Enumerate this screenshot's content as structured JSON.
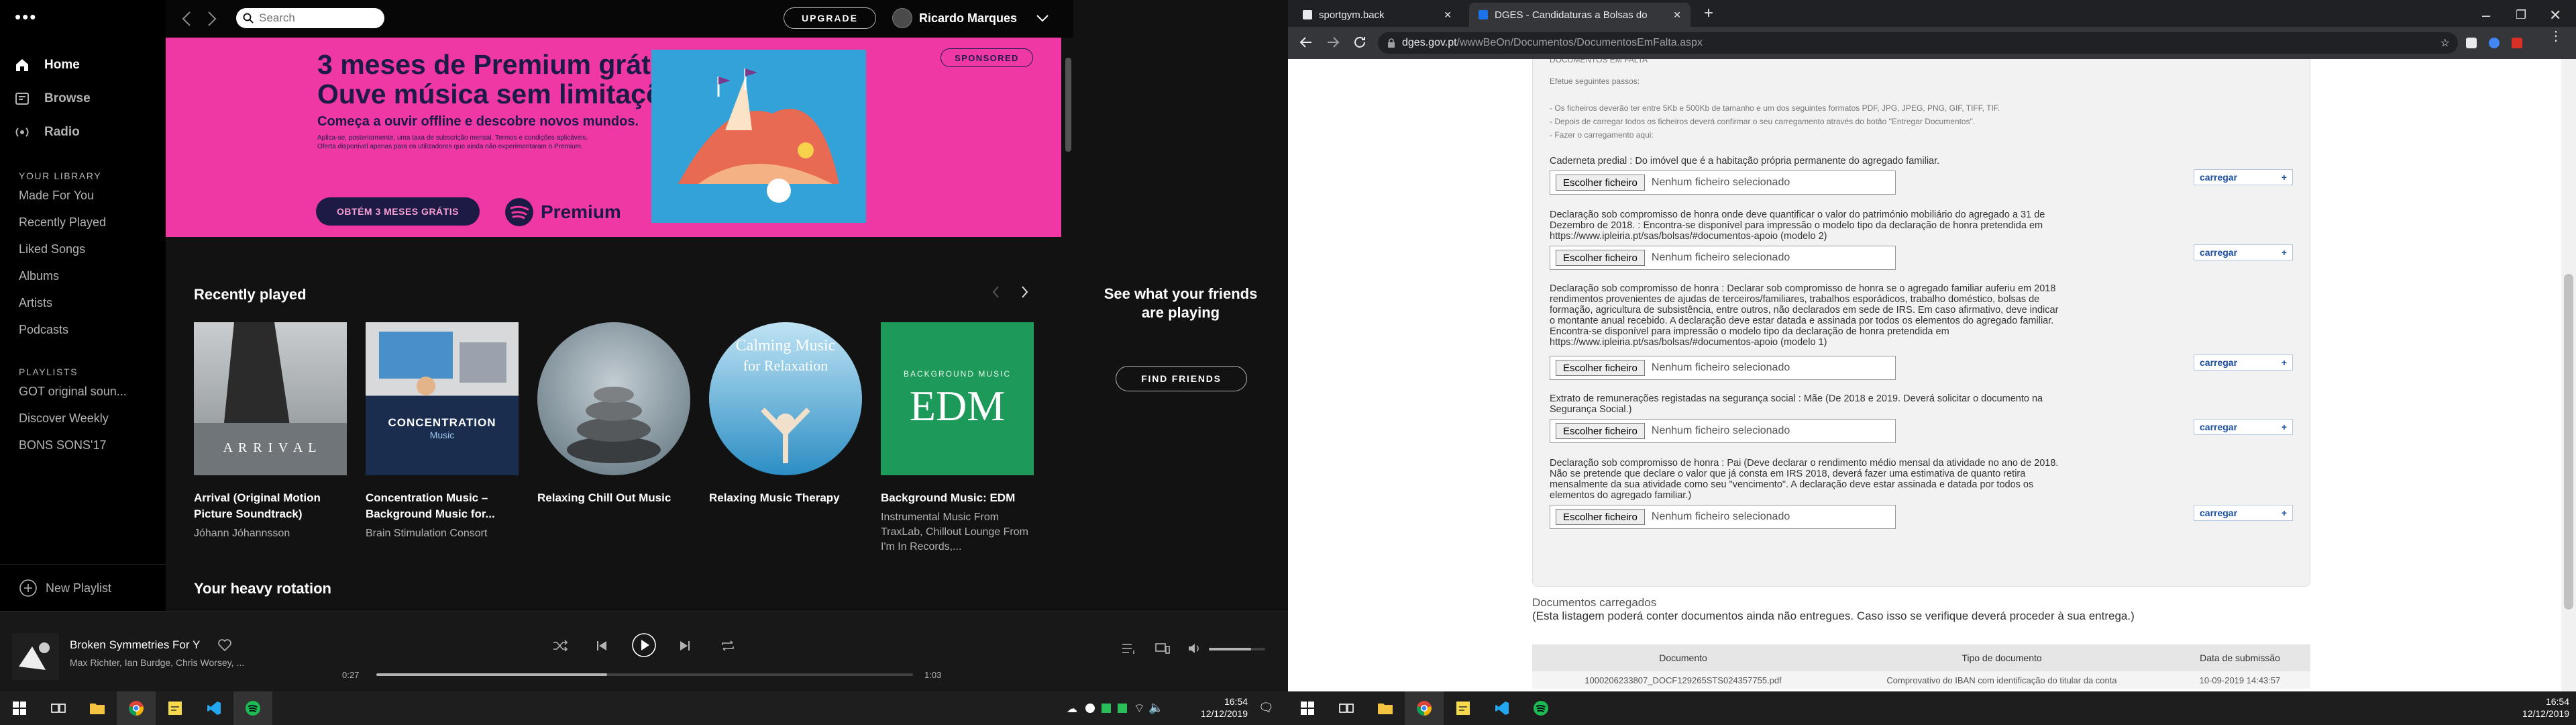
{
  "spotify": {
    "search_placeholder": "Search",
    "upgrade_label": "UPGRADE",
    "user_name": "Ricardo Marques",
    "nav": [
      {
        "label": "Home",
        "icon": "home-icon"
      },
      {
        "label": "Browse",
        "icon": "browse-icon"
      },
      {
        "label": "Radio",
        "icon": "radio-icon"
      }
    ],
    "library_header": "YOUR LIBRARY",
    "library": [
      "Made For You",
      "Recently Played",
      "Liked Songs",
      "Albums",
      "Artists",
      "Podcasts"
    ],
    "playlists_header": "PLAYLISTS",
    "playlists": [
      "GOT original soun...",
      "Discover Weekly",
      "BONS SONS'17"
    ],
    "new_playlist": "New Playlist",
    "ad": {
      "headline_1": "3 meses de Premium grátis.",
      "headline_2": "Ouve música sem limitações.",
      "subline": "Começa a ouvir offline e descobre novos mundos.",
      "fine_1": "Aplica-se, posteriormente, uma taxa de subscrição mensal. Termos e condições aplicáveis.",
      "fine_2": "Oferta disponível apenas para os utilizadores que ainda não experimentaram o Premium.",
      "cta": "OBTÉM 3 MESES GRÁTIS",
      "brand": "Premium",
      "sponsored": "SPONSORED"
    },
    "recently_played_title": "Recently played",
    "recently_played": [
      {
        "title": "Arrival (Original Motion Picture Soundtrack)",
        "sub": "Jóhann Jóhannsson",
        "art_text": "A R R I V A L"
      },
      {
        "title": "Concentration Music – Background Music for...",
        "sub": "Brain Stimulation Consort",
        "art_text": "CONCENTRATION",
        "art_text2": "Music"
      },
      {
        "title": "Relaxing Chill Out Music",
        "sub": ""
      },
      {
        "title": "Relaxing Music Therapy",
        "sub": "",
        "art_text": "Calming Music",
        "art_text2": "for Relaxation"
      },
      {
        "title": "Background Music: EDM",
        "sub": "Instrumental Music From TraxLab, Chillout Lounge From I'm In Records,...",
        "art_text": "EDM",
        "art_text2": "BACKGROUND MUSIC"
      }
    ],
    "heavy_rotation_title": "Your heavy rotation",
    "friends_text": "See what your friends are playing",
    "find_friends": "FIND FRIENDS",
    "player": {
      "track": "Broken Symmetries For Y",
      "artists": "Max Richter, Ian Burdge, Chris Worsey, ...",
      "elapsed": "0:27",
      "duration": "1:03",
      "progress": 0.43,
      "volume": 0.75
    }
  },
  "chrome": {
    "tabs": [
      {
        "title": "sportgym.back",
        "active": false
      },
      {
        "title": "DGES - Candidaturas a Bolsas do",
        "active": true
      }
    ],
    "url_host": "dges.gov.pt",
    "url_path": "/wwwBeOn/Documentos/DocumentosEmFalta.aspx",
    "header_cut": "DOCUMENTOS EM FALTA",
    "steps_title": "Efetue seguintes passos:",
    "steps": [
      "- Os ficheiros deverão ter entre 5Kb e 500Kb de tamanho e um dos seguintes formatos PDF, JPG, JPEG, PNG, GIF, TIFF, TIF.",
      "- Depois de carregar todos os ficheiros deverá confirmar o seu carregamento através do botão \"Entregar Documentos\".",
      "- Fazer o carregamento aqui:"
    ],
    "file_button": "Escolher ficheiro",
    "file_none": "Nenhum ficheiro selecionado",
    "upload_label": "carregar",
    "items": [
      {
        "text": "Caderneta predial : Do imóvel que é a habitação própria permanente do agregado familiar."
      },
      {
        "text": "Declaração sob compromisso de honra onde deve quantificar o valor do património mobiliário do agregado a 31 de Dezembro de 2018. : Encontra-se disponível para impressão o modelo tipo da declaração de honra pretendida em https://www.ipleiria.pt/sas/bolsas/#documentos-apoio (modelo 2)"
      },
      {
        "text": "Declaração sob compromisso de honra : Declarar sob compromisso de honra se o agregado familiar auferiu em 2018 rendimentos provenientes de ajudas de terceiros/familiares, trabalhos esporádicos, trabalho doméstico, bolsas de formação, agricultura de subsistência, entre outros, não declarados em sede de IRS. Em caso afirmativo, deve indicar o montante anual recebido. A declaração deve estar datada e assinada por todos os elementos do agregado familiar. Encontra-se disponível para impressão o modelo tipo da declaração de honra pretendida em https://www.ipleiria.pt/sas/bolsas/#documentos-apoio (modelo 1)"
      },
      {
        "text": "Extrato de remunerações registadas na segurança social : Mãe (De 2018 e 2019. Deverá solicitar o documento na Segurança Social.)"
      },
      {
        "text": "Declaração sob compromisso de honra : Pai (Deve declarar o rendimento médio mensal da atividade no ano de 2018. Não se pretende que declare o valor que já consta em IRS 2018, deverá fazer uma estimativa de quanto retira mensalmente da sua atividade como seu \"vencimento\". A declaração deve estar assinada e datada por todos os elementos do agregado familiar.)"
      }
    ],
    "loaded_title": "Documentos carregados",
    "loaded_note": "(Esta listagem poderá conter documentos ainda não entregues. Caso isso se verifique deverá proceder à sua entrega.)",
    "table_headers": [
      "Documento",
      "Tipo de documento",
      "Data de submissão"
    ],
    "table_rows": [
      [
        "1000206233807_DOCF129265STS024357755.pdf",
        "Comprovativo do IBAN com identificação do titular da conta",
        "10-09-2019 14:43:57"
      ]
    ]
  },
  "taskbar": {
    "time": "16:54",
    "date": "12/12/2019"
  }
}
